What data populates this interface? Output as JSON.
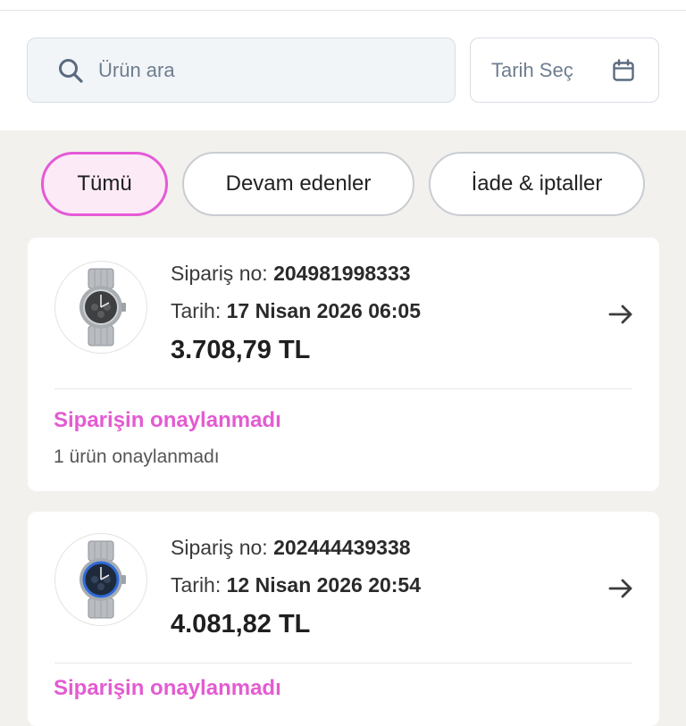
{
  "search": {
    "placeholder": "Ürün ara"
  },
  "date_filter": {
    "label": "Tarih Seç"
  },
  "filters": [
    {
      "label": "Tümü",
      "active": true
    },
    {
      "label": "Devam edenler",
      "active": false
    },
    {
      "label": "İade & iptaller",
      "active": false
    }
  ],
  "orders": [
    {
      "order_label": "Sipariş no:",
      "order_no": "204981998333",
      "date_label": "Tarih:",
      "date": "17 Nisan 2026 06:05",
      "price": "3.708,79 TL",
      "status": "Siparişin onaylanmadı",
      "status_detail": "1 ürün onaylanmadı"
    },
    {
      "order_label": "Sipariş no:",
      "order_no": "202444439338",
      "date_label": "Tarih:",
      "date": "12 Nisan 2026 20:54",
      "price": "4.081,82 TL",
      "status": "Siparişin onaylanmadı"
    }
  ],
  "colors": {
    "accent": "#e35bd2",
    "active_chip_bg": "#fdeaf7",
    "page_bg": "#f2f1ed"
  },
  "icons": {
    "search": "search-icon",
    "calendar": "calendar-icon",
    "arrow": "arrow-right-icon",
    "product": "watch-icon"
  }
}
